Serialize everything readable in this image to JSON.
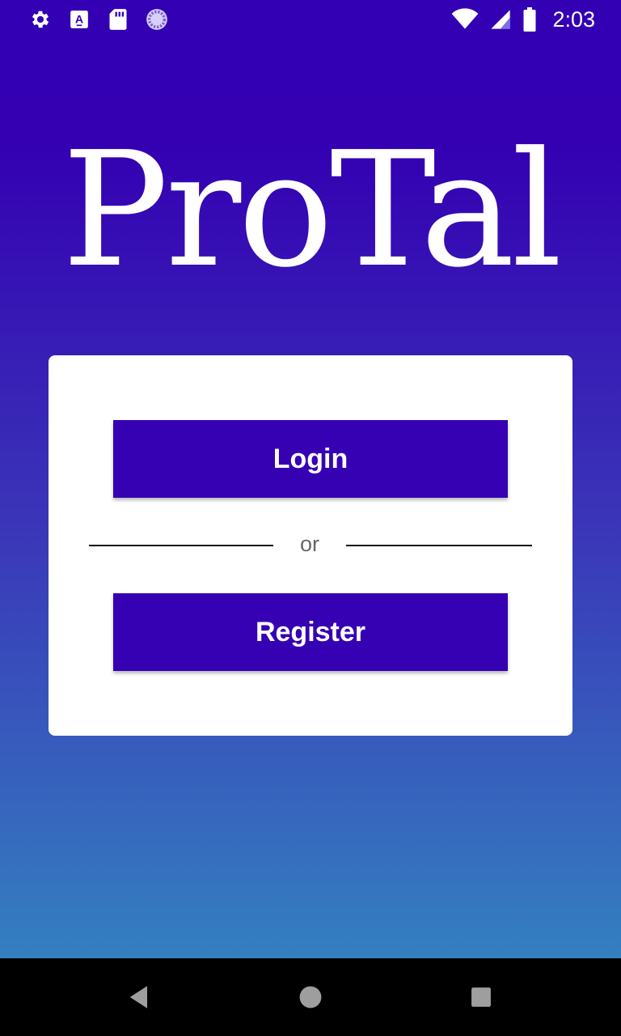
{
  "status_bar": {
    "time": "2:03",
    "left_icons": [
      "settings-icon",
      "font-icon",
      "sd-card-icon",
      "sync-circle-icon"
    ],
    "right_icons": [
      "wifi-icon",
      "signal-icon",
      "battery-icon"
    ]
  },
  "app": {
    "logo_text": "ProTal"
  },
  "card": {
    "login_label": "Login",
    "divider_text": "or",
    "register_label": "Register"
  },
  "nav_bar": {
    "icons": [
      "back-icon",
      "home-icon",
      "recents-icon"
    ]
  },
  "colors": {
    "primary": "#3600b3",
    "gradient_top": "#3300b4",
    "gradient_bottom": "#3480c0",
    "card_background": "#ffffff"
  }
}
